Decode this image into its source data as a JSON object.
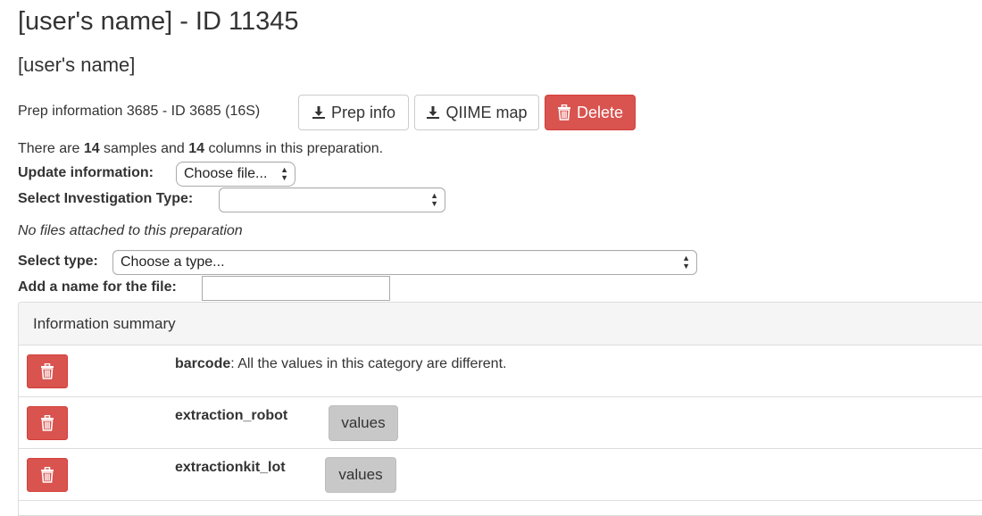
{
  "page": {
    "title": "[user's name] - ID 11345",
    "subtitle": "[user's name]"
  },
  "prep": {
    "label": "Prep information 3685 - ID 3685 (16S)",
    "prep_info_button": "Prep info",
    "qiime_map_button": "QIIME map",
    "delete_button": "Delete"
  },
  "summary_line": {
    "pre": "There are ",
    "samples": "14",
    "mid": " samples and ",
    "columns": "14",
    "post": " columns in this preparation."
  },
  "update": {
    "label": "Update information:",
    "file_button": "Choose file..."
  },
  "investigation": {
    "label": "Select Investigation Type:",
    "value": ""
  },
  "no_files_text": "No files attached to this preparation",
  "select_type": {
    "label": "Select type:",
    "value": "Choose a type..."
  },
  "file_name": {
    "label": "Add a name for the file:",
    "value": ""
  },
  "info_summary": {
    "heading": "Information summary",
    "rows": [
      {
        "name": "barcode",
        "desc": ": All the values in this category are different.",
        "values_label": ""
      },
      {
        "name": "extraction_robot",
        "desc": "",
        "values_label": "values"
      },
      {
        "name": "extractionkit_lot",
        "desc": "",
        "values_label": "values"
      }
    ]
  },
  "icons": {
    "download": "download-icon",
    "trash": "trash-icon"
  },
  "colors": {
    "danger": "#d9534f",
    "values_button": "#c8c8c8",
    "panel_heading": "#f5f5f5"
  }
}
